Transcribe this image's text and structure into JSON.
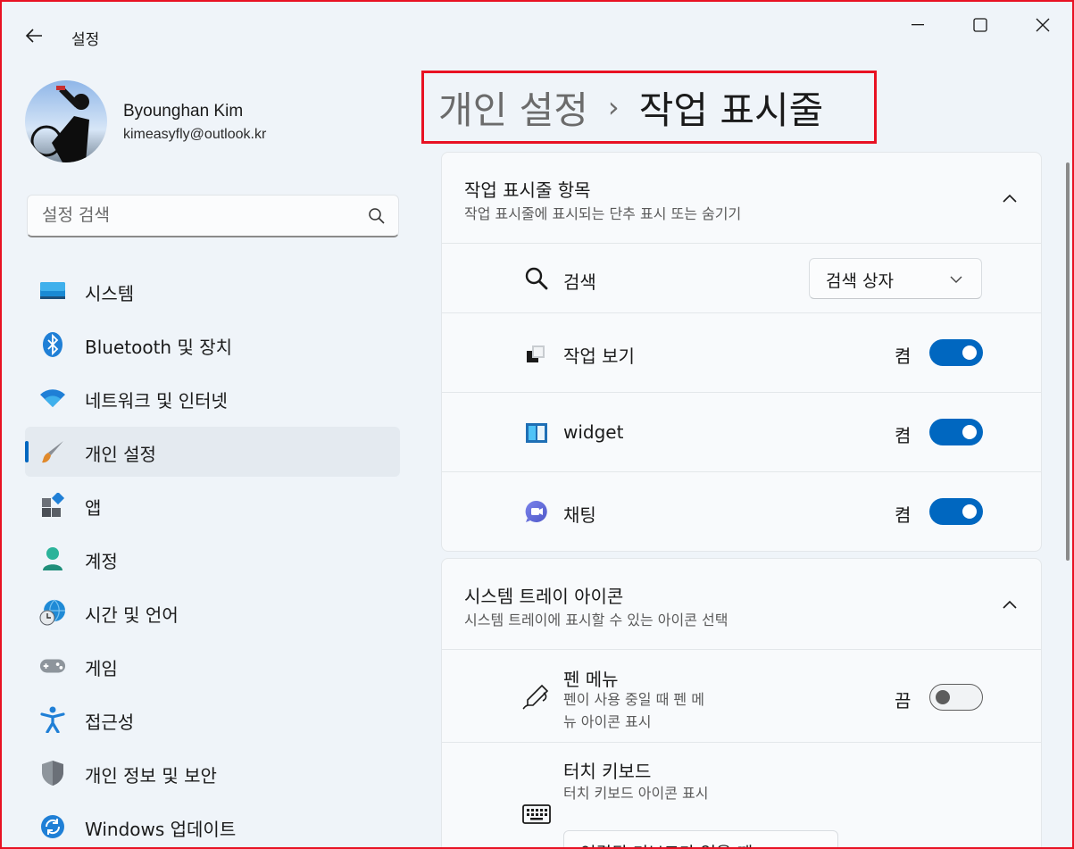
{
  "window": {
    "app_title": "설정",
    "border_color": "#e81123"
  },
  "profile": {
    "name": "Byounghan Kim",
    "email": "kimeasyfly@outlook.kr"
  },
  "search": {
    "placeholder": "설정 검색",
    "value": ""
  },
  "sidebar": {
    "selected": "개인 설정",
    "items": [
      {
        "label": "시스템",
        "icon": "monitor-icon"
      },
      {
        "label": "Bluetooth 및 장치",
        "icon": "bluetooth-icon"
      },
      {
        "label": "네트워크 및 인터넷",
        "icon": "wifi-icon"
      },
      {
        "label": "개인 설정",
        "icon": "paintbrush-icon"
      },
      {
        "label": "앱",
        "icon": "apps-icon"
      },
      {
        "label": "계정",
        "icon": "account-icon"
      },
      {
        "label": "시간 및 언어",
        "icon": "globe-clock-icon"
      },
      {
        "label": "게임",
        "icon": "gamepad-icon"
      },
      {
        "label": "접근성",
        "icon": "accessibility-icon"
      },
      {
        "label": "개인 정보 및 보안",
        "icon": "shield-icon"
      },
      {
        "label": "Windows 업데이트",
        "icon": "update-icon"
      }
    ]
  },
  "header": {
    "parent": "개인 설정",
    "separator": "›",
    "current": "작업 표시줄"
  },
  "taskbar_items": {
    "title": "작업 표시줄 항목",
    "subtitle": "작업 표시줄에 표시되는 단추 표시 또는 숨기기",
    "rows": {
      "search": {
        "label": "검색",
        "dropdown_value": "검색 상자"
      },
      "task_view": {
        "label": "작업 보기",
        "state": "켬"
      },
      "widget": {
        "label": "widget",
        "state": "켬"
      },
      "chat": {
        "label": "채팅",
        "state": "켬"
      }
    }
  },
  "system_tray": {
    "title": "시스템 트레이 아이콘",
    "subtitle": "시스템 트레이에 표시할 수 있는 아이콘 선택",
    "rows": {
      "pen_menu": {
        "label": "펜 메뉴",
        "sub_line1": "펜이 사용 중일 때 펜 메",
        "sub_line2": "뉴 아이콘 표시",
        "state": "끔"
      },
      "touch_keyboard": {
        "label": "터치 키보드",
        "sub": "터치 키보드 아이콘 표시",
        "dropdown_value": "연결된 키보드가 없을 때"
      }
    }
  },
  "colors": {
    "accent": "#0067c0",
    "highlight_border": "#e81123"
  }
}
